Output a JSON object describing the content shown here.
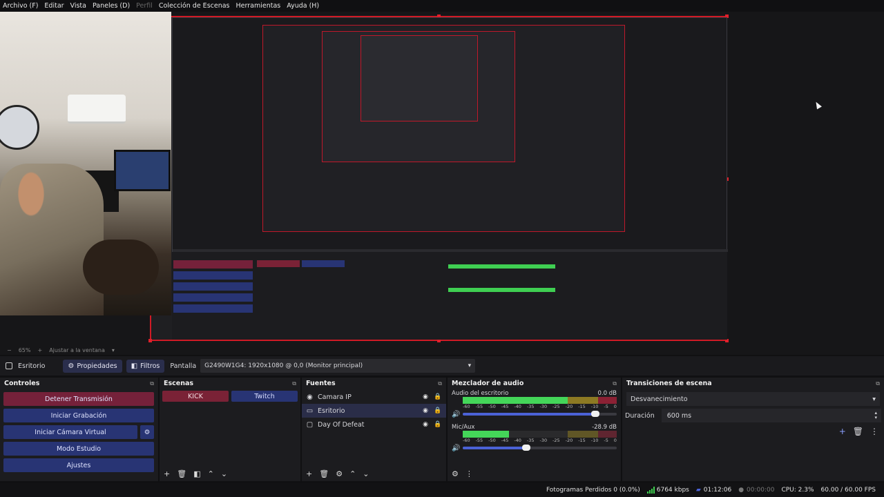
{
  "menu": [
    "Archivo (F)",
    "Editar",
    "Vista",
    "Paneles (D)",
    "Perfil",
    "Colección de Escenas",
    "Herramientas",
    "Ayuda (H)"
  ],
  "preview_bar": {
    "zoom": "65%",
    "fit_label": "Ajustar a la ventana"
  },
  "source_bar": {
    "source_name": "Esritorio",
    "properties_label": "Propiedades",
    "filters_label": "Filtros",
    "screen_label": "Pantalla",
    "screen_value": "G2490W1G4: 1920x1080 @ 0,0 (Monitor principal)"
  },
  "controls": {
    "title": "Controles",
    "buttons": [
      "Detener Transmisión",
      "Iniciar Grabación",
      "Iniciar Cámara Virtual",
      "Modo Estudio",
      "Ajustes"
    ]
  },
  "scenes": {
    "title": "Escenas",
    "items": [
      "KICK",
      "Twitch"
    ]
  },
  "sources": {
    "title": "Fuentes",
    "items": [
      {
        "name": "Camara IP",
        "icon": "camera-icon"
      },
      {
        "name": "Esritorio",
        "icon": "monitor-icon"
      },
      {
        "name": "Day Of Defeat",
        "icon": "window-icon"
      }
    ]
  },
  "mixer": {
    "title": "Mezclador de audio",
    "tracks": [
      {
        "name": "Audio del escritorio",
        "db": "0.0 dB",
        "level": 0.86
      },
      {
        "name": "Mic/Aux",
        "db": "-28.9 dB",
        "level": 0.41
      }
    ],
    "ticks": [
      "-60",
      "-55",
      "-50",
      "-45",
      "-40",
      "-35",
      "-30",
      "-25",
      "-20",
      "-15",
      "-10",
      "-5",
      "0"
    ]
  },
  "transitions": {
    "title": "Transiciones de escena",
    "selected": "Desvanecimiento",
    "duration_label": "Duración",
    "duration_value": "600 ms"
  },
  "status": {
    "dropped": "Fotogramas Perdidos 0 (0.0%)",
    "kbps": "6764 kbps",
    "stream_time": "01:12:06",
    "rec_time": "00:00:00",
    "cpu": "CPU: 2.3%",
    "fps": "60.00 / 60.00 FPS"
  },
  "colors": {
    "accent_red": "#d01a25",
    "button_blue": "#283474",
    "stop_button": "#75213a"
  }
}
